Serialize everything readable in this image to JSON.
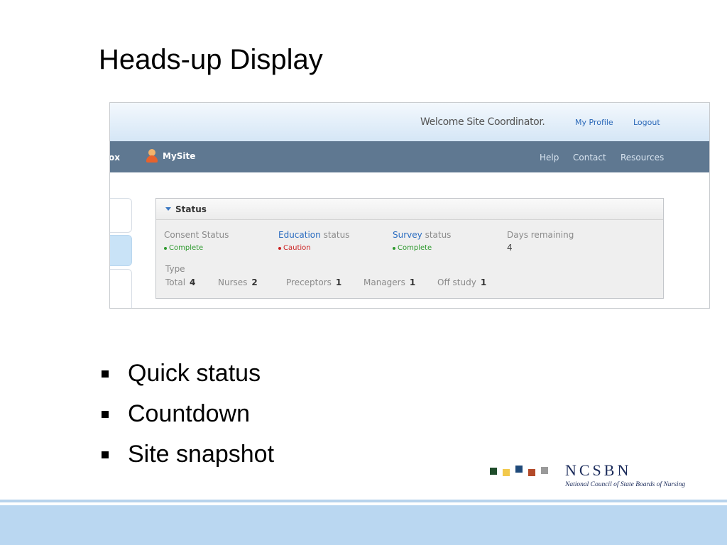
{
  "slide": {
    "title": "Heads-up Display",
    "bullets": [
      "Quick status",
      "Countdown",
      "Site snapshot"
    ]
  },
  "app": {
    "welcome": "Welcome Site Coordinator.",
    "my_profile": "My Profile",
    "logout": "Logout",
    "nav_cut": "ox",
    "nav_site": "MySite",
    "nav_links": [
      "Help",
      "Contact",
      "Resources"
    ]
  },
  "status_panel": {
    "title": "Status",
    "columns": [
      {
        "label_prefix": "Consent Status",
        "label_suffix": "",
        "value": "Complete",
        "state": "green"
      },
      {
        "label_prefix": "Education",
        "label_suffix": " status",
        "value": "Caution",
        "state": "red"
      },
      {
        "label_prefix": "Survey",
        "label_suffix": " status",
        "value": "Complete",
        "state": "green"
      },
      {
        "label_prefix": "Days remaining",
        "label_suffix": "",
        "value": "4",
        "state": "number"
      }
    ],
    "type_label": "Type",
    "type_counts": [
      {
        "label": "Total",
        "value": "4"
      },
      {
        "label": "Nurses",
        "value": "2"
      },
      {
        "label": "Preceptors",
        "value": "1"
      },
      {
        "label": "Managers",
        "value": "1"
      },
      {
        "label": "Off study",
        "value": "1"
      }
    ]
  },
  "logo": {
    "wordmark": "NCSBN",
    "subtitle": "National Council of State Boards of Nursing",
    "square_colors": [
      "#1f4d2b",
      "#f2c94c",
      "#1f4a7a",
      "#b34a2a",
      "#9a9a9a"
    ]
  },
  "colors": {
    "footer": "#bad7f1",
    "nav": "#5f7891",
    "link": "#2a68b8",
    "complete": "#2f9a2f",
    "caution": "#cc2222"
  }
}
